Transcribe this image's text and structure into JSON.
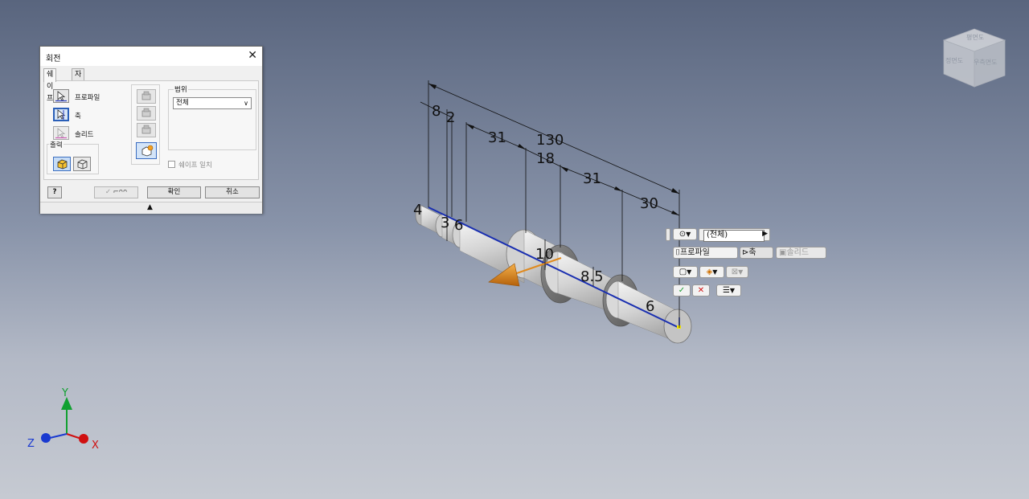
{
  "dialog": {
    "title": "회전",
    "tabs": [
      "쉐이프",
      "자세히"
    ],
    "selectors": {
      "profile": "프로파일",
      "axis": "축",
      "solid": "솔리드"
    },
    "output_label": "출력",
    "range_label": "범위",
    "range_value": "전체",
    "match_shape": "쉐이프 일치",
    "ok": "확인",
    "cancel": "취소",
    "help": "?"
  },
  "dimensions": {
    "d130": "130",
    "d8": "8",
    "d2": "2",
    "d31a": "31",
    "d18": "18",
    "d31b": "31",
    "d30": "30",
    "d4": "4",
    "d3": "3",
    "d6a": "6",
    "d10": "10",
    "d85": "8.5",
    "d6b": "6"
  },
  "minitoolbar": {
    "range_value": "(전체)",
    "profile": "프로파일",
    "axis": "축",
    "solid": "솔리드"
  },
  "viewcube": {
    "front": "정면도",
    "right": "우측면도",
    "top": "평면도"
  },
  "axes": {
    "x": "X",
    "y": "Y",
    "z": "Z"
  },
  "colors": {
    "axis_line": "#1a2fb0",
    "preview_arrow": "#e08a1e",
    "x_axis": "#d01010",
    "y_axis": "#10a030",
    "z_axis": "#1a3ad0"
  }
}
